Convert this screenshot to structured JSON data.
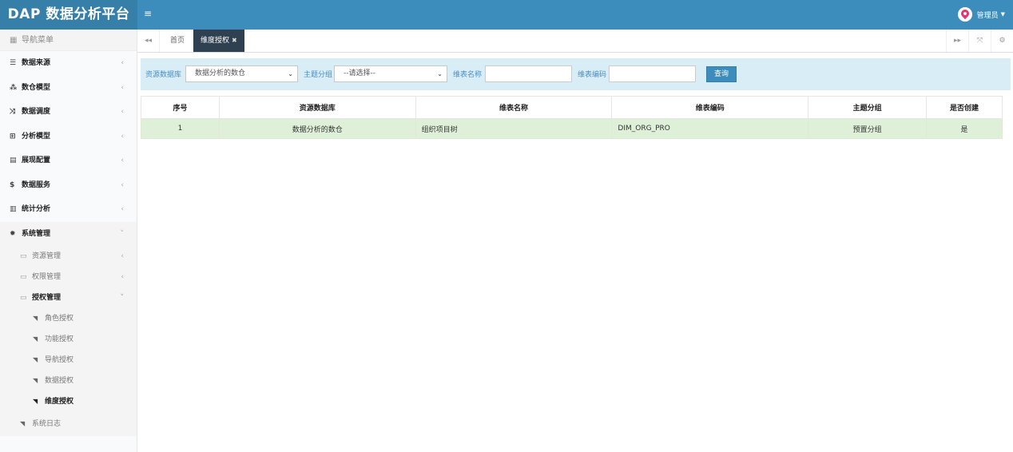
{
  "app": {
    "title": "DAP 数据分析平台"
  },
  "user": {
    "name": "管理员"
  },
  "sidebar": {
    "header": "导航菜单",
    "items": [
      {
        "label": "数据来源"
      },
      {
        "label": "数仓模型"
      },
      {
        "label": "数据调度"
      },
      {
        "label": "分析模型"
      },
      {
        "label": "展现配置"
      },
      {
        "label": "数据服务"
      },
      {
        "label": "统计分析"
      },
      {
        "label": "系统管理"
      }
    ],
    "system_sub": [
      {
        "label": "资源管理"
      },
      {
        "label": "权限管理"
      },
      {
        "label": "授权管理"
      }
    ],
    "auth_leaves": [
      {
        "label": "角色授权"
      },
      {
        "label": "功能授权"
      },
      {
        "label": "导航授权"
      },
      {
        "label": "数据授权"
      },
      {
        "label": "维度授权"
      }
    ],
    "log": "系统日志"
  },
  "tabs": {
    "home": "首页",
    "active": "维度授权"
  },
  "filter": {
    "db_label": "资源数据库",
    "db_value": "数据分析的数仓",
    "group_label": "主题分组",
    "group_value": "--请选择--",
    "name_label": "维表名称",
    "name_value": "",
    "code_label": "维表编码",
    "code_value": "",
    "search_label": "查询"
  },
  "table": {
    "headers": [
      "序号",
      "资源数据库",
      "维表名称",
      "维表编码",
      "主题分组",
      "是否创建"
    ],
    "rows": [
      [
        "1",
        "数据分析的数仓",
        "组织项目树",
        "DIM_ORG_PRO",
        "预置分组",
        "是"
      ]
    ]
  }
}
